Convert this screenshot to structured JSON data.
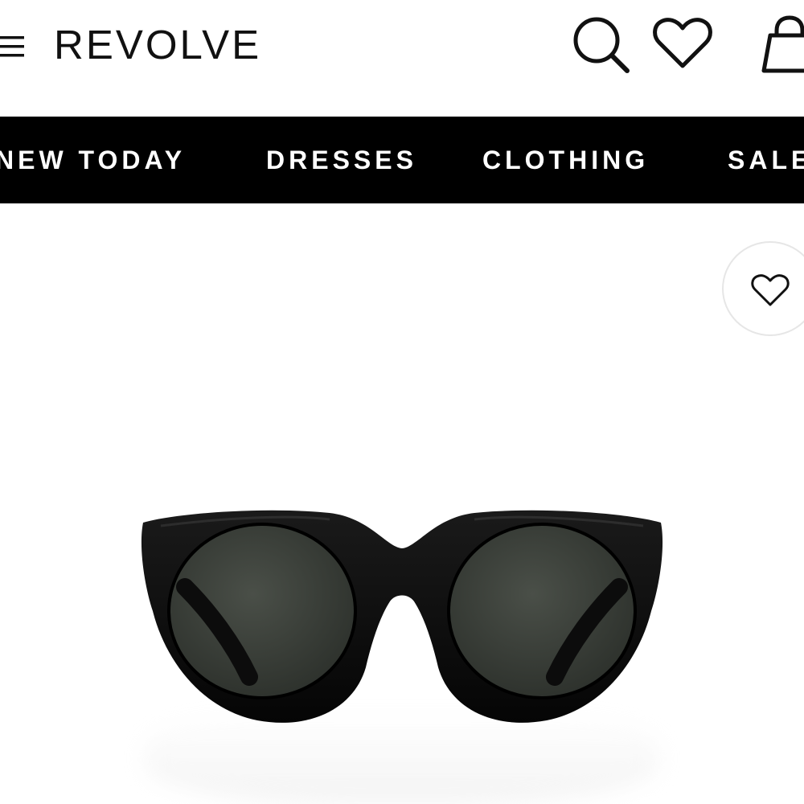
{
  "header": {
    "brand": "REVOLVE",
    "icons": {
      "menu": "hamburger-menu-icon",
      "search": "search-icon",
      "wishlist": "heart-icon",
      "bag": "shopping-bag-icon"
    }
  },
  "nav": {
    "items": [
      {
        "label": "NEW TODAY"
      },
      {
        "label": "DRESSES"
      },
      {
        "label": "CLOTHING"
      },
      {
        "label": "SALE"
      }
    ]
  },
  "product": {
    "image": "black-cat-eye-sunglasses",
    "wishlist_icon": "heart-outline-icon"
  },
  "colors": {
    "nav_background": "#000000",
    "nav_text": "#ffffff",
    "frame": "#0a0a0a",
    "lens": "#3b3f3a"
  }
}
